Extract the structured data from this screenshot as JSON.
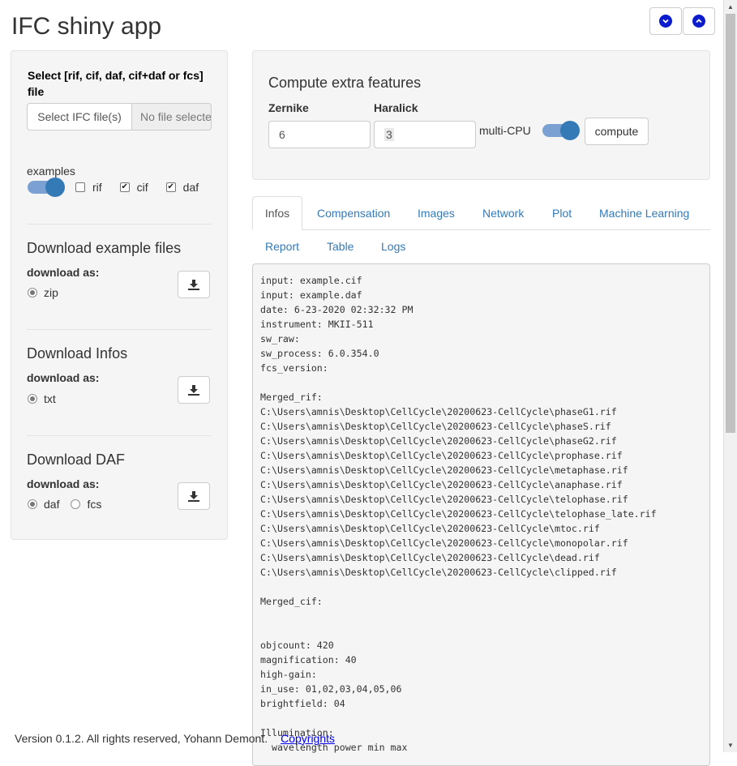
{
  "app": {
    "title": "IFC shiny app"
  },
  "sidebar": {
    "select_label": "Select [rif, cif, daf, cif+daf or fcs] file",
    "file_button": "Select IFC file(s)",
    "file_status": "No file selected",
    "examples_label": "examples",
    "examples_checkboxes": [
      {
        "label": "rif",
        "checked": false
      },
      {
        "label": "cif",
        "checked": true
      },
      {
        "label": "daf",
        "checked": true
      }
    ],
    "sections": [
      {
        "title": "Download example files",
        "download_as": "download as:",
        "options": [
          {
            "label": "zip",
            "selected": true
          }
        ]
      },
      {
        "title": "Download Infos",
        "download_as": "download as:",
        "options": [
          {
            "label": "txt",
            "selected": true
          }
        ]
      },
      {
        "title": "Download DAF",
        "download_as": "download as:",
        "options": [
          {
            "label": "daf",
            "selected": true
          },
          {
            "label": "fcs",
            "selected": false
          }
        ]
      }
    ]
  },
  "compute": {
    "title": "Compute extra features",
    "zernike_label": "Zernike",
    "zernike_value": "6",
    "haralick_label": "Haralick",
    "haralick_value": "3",
    "multicpu_label": "multi-CPU",
    "button": "compute"
  },
  "tabs": [
    {
      "label": "Infos",
      "active": true
    },
    {
      "label": "Compensation"
    },
    {
      "label": "Images"
    },
    {
      "label": "Network"
    },
    {
      "label": "Plot"
    },
    {
      "label": "Machine Learning"
    },
    {
      "label": "Report"
    },
    {
      "label": "Table"
    },
    {
      "label": "Logs"
    }
  ],
  "infos": {
    "lines": [
      "input: example.cif",
      "input: example.daf",
      "date: 6-23-2020 02:32:32 PM",
      "instrument: MKII-511",
      "sw_raw:",
      "sw_process: 6.0.354.0",
      "fcs_version:",
      "",
      "Merged_rif:",
      "C:\\Users\\amnis\\Desktop\\CellCycle\\20200623-CellCycle\\phaseG1.rif",
      "C:\\Users\\amnis\\Desktop\\CellCycle\\20200623-CellCycle\\phaseS.rif",
      "C:\\Users\\amnis\\Desktop\\CellCycle\\20200623-CellCycle\\phaseG2.rif",
      "C:\\Users\\amnis\\Desktop\\CellCycle\\20200623-CellCycle\\prophase.rif",
      "C:\\Users\\amnis\\Desktop\\CellCycle\\20200623-CellCycle\\metaphase.rif",
      "C:\\Users\\amnis\\Desktop\\CellCycle\\20200623-CellCycle\\anaphase.rif",
      "C:\\Users\\amnis\\Desktop\\CellCycle\\20200623-CellCycle\\telophase.rif",
      "C:\\Users\\amnis\\Desktop\\CellCycle\\20200623-CellCycle\\telophase_late.rif",
      "C:\\Users\\amnis\\Desktop\\CellCycle\\20200623-CellCycle\\mtoc.rif",
      "C:\\Users\\amnis\\Desktop\\CellCycle\\20200623-CellCycle\\monopolar.rif",
      "C:\\Users\\amnis\\Desktop\\CellCycle\\20200623-CellCycle\\dead.rif",
      "C:\\Users\\amnis\\Desktop\\CellCycle\\20200623-CellCycle\\clipped.rif",
      "",
      "Merged_cif:",
      "",
      "",
      "objcount: 420",
      "magnification: 40",
      "high-gain:",
      "in_use: 01,02,03,04,05,06",
      "brightfield: 04",
      "",
      "Illumination:",
      "  wavelength power min max"
    ]
  },
  "footer": {
    "version_text": "Version 0.1.2. All rights reserved, Yohann Demont.",
    "copyrights_link": "Copyrights"
  }
}
